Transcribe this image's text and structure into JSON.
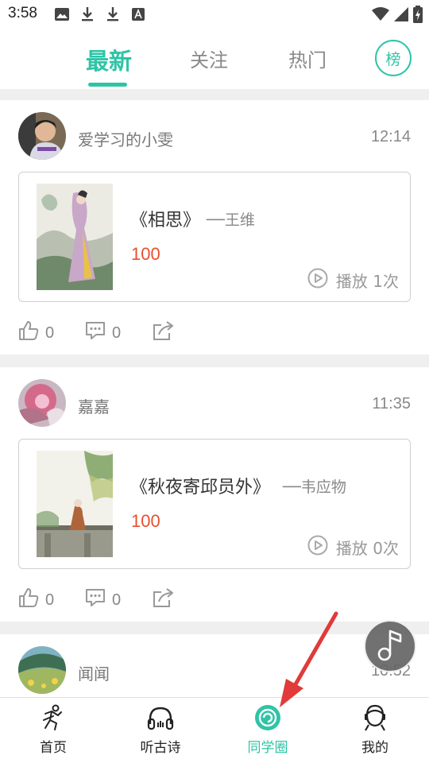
{
  "status_bar": {
    "time": "3:58",
    "icons": [
      "image-icon",
      "download-icon",
      "download-icon",
      "a-box-icon",
      "wifi-icon",
      "signal-icon",
      "battery-icon"
    ]
  },
  "top_tabs": {
    "tabs": [
      {
        "label": "最新",
        "active": true
      },
      {
        "label": "关注",
        "active": false
      },
      {
        "label": "热门",
        "active": false
      }
    ],
    "rank_label": "榜"
  },
  "posts": [
    {
      "username": "爱学习的小雯",
      "time": "12:14",
      "card": {
        "title": "《相思》",
        "author": "──王维",
        "score": "100",
        "play_text": "播放 1次"
      },
      "likes": "0",
      "comments": "0"
    },
    {
      "username": "嘉嘉",
      "time": "11:35",
      "card": {
        "title": "《秋夜寄邱员外》",
        "author": "──韦应物",
        "score": "100",
        "play_text": "播放 0次"
      },
      "likes": "0",
      "comments": "0"
    },
    {
      "username": "闻闻",
      "time": "10:52"
    }
  ],
  "bottom_nav": {
    "items": [
      {
        "label": "首页",
        "icon": "home-figure-icon",
        "active": false
      },
      {
        "label": "听古诗",
        "icon": "headphones-icon",
        "active": false
      },
      {
        "label": "同学圈",
        "icon": "circle-icon",
        "active": true
      },
      {
        "label": "我的",
        "icon": "profile-icon",
        "active": false
      }
    ]
  },
  "colors": {
    "accent": "#2ec4a6",
    "score": "#e8502f",
    "arrow": "#e03a3a"
  }
}
